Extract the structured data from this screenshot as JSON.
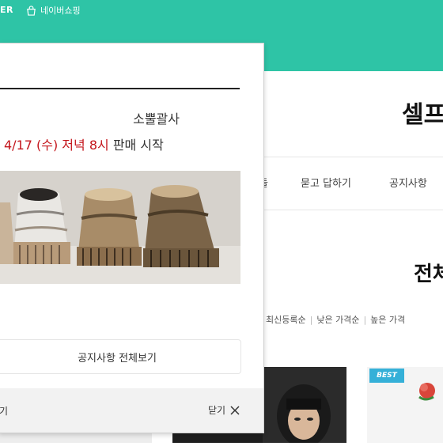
{
  "topbar": {
    "brand": "ER",
    "shopping_label": "네이버쇼핑"
  },
  "store": {
    "title": "셀프"
  },
  "nav": {
    "items": [
      "들",
      "묻고 답하기",
      "공지사항"
    ]
  },
  "section": {
    "title": "전체"
  },
  "sort": {
    "options": [
      "최신등록순",
      "낮은 가격순",
      "높은 가격"
    ]
  },
  "badges": {
    "best": "BEST"
  },
  "modal": {
    "subtitle": "소뿔괄사",
    "date_highlight": "4/17 (수) 저녁 8시",
    "date_rest": "판매 시작",
    "notice_button": "공지사항 전체보기",
    "footer_left": "기",
    "footer_close": "닫기"
  },
  "colors": {
    "accent": "#2ec4a6",
    "highlight": "#c4161c",
    "best_badge": "#35b0d8"
  },
  "icons": {
    "shop": "shopping-bag-icon",
    "close": "close-icon"
  }
}
